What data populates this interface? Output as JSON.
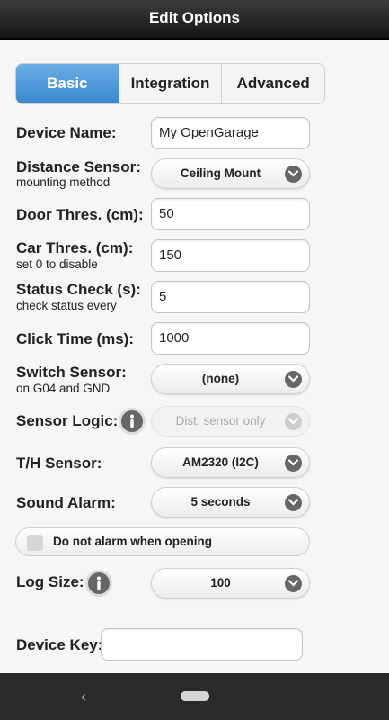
{
  "header": {
    "title": "Edit Options"
  },
  "tabs": [
    {
      "label": "Basic",
      "active": true
    },
    {
      "label": "Integration",
      "active": false
    },
    {
      "label": "Advanced",
      "active": false
    }
  ],
  "form": {
    "device_name": {
      "label": "Device Name:",
      "value": "My OpenGarage"
    },
    "distance_sensor": {
      "label": "Distance Sensor:",
      "sub": "mounting method",
      "value": "Ceiling Mount"
    },
    "door_threshold": {
      "label": "Door Thres. (cm):",
      "value": "50"
    },
    "car_threshold": {
      "label": "Car Thres. (cm):",
      "sub": "set 0 to disable",
      "value": "150"
    },
    "status_check": {
      "label": "Status Check (s):",
      "sub": "check status every",
      "value": "5"
    },
    "click_time": {
      "label": "Click Time (ms):",
      "value": "1000"
    },
    "switch_sensor": {
      "label": "Switch Sensor:",
      "sub": "on G04 and GND",
      "value": "(none)"
    },
    "sensor_logic": {
      "label": "Sensor Logic:",
      "value": "Dist. sensor only"
    },
    "th_sensor": {
      "label": "T/H Sensor:",
      "value": "AM2320 (I2C)"
    },
    "sound_alarm": {
      "label": "Sound Alarm:",
      "value": "5 seconds"
    },
    "no_alarm_opening": {
      "label": "Do not alarm when opening",
      "checked": false
    },
    "log_size": {
      "label": "Log Size:",
      "value": "100"
    },
    "device_key": {
      "label": "Device Key:",
      "value": ""
    }
  },
  "navbar": {
    "back_icon": "back-chevron-icon",
    "home_icon": "home-pill-icon"
  }
}
